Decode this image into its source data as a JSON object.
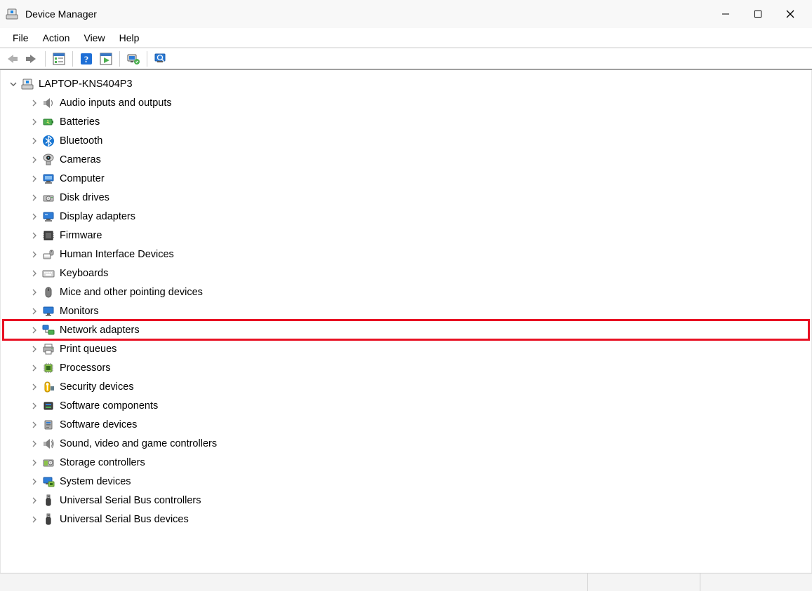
{
  "window": {
    "title": "Device Manager"
  },
  "menu": {
    "file": "File",
    "action": "Action",
    "view": "View",
    "help": "Help"
  },
  "toolbar": {
    "back": "Back",
    "forward": "Forward",
    "properties": "Show/Hide Console Tree",
    "help": "Help",
    "action_panel": "Properties",
    "scan": "Scan for hardware changes",
    "monitor": "Devices and Printers"
  },
  "tree": {
    "root": "LAPTOP-KNS404P3",
    "items": [
      {
        "label": "Audio inputs and outputs",
        "icon": "speaker"
      },
      {
        "label": "Batteries",
        "icon": "battery"
      },
      {
        "label": "Bluetooth",
        "icon": "bluetooth"
      },
      {
        "label": "Cameras",
        "icon": "camera"
      },
      {
        "label": "Computer",
        "icon": "computer"
      },
      {
        "label": "Disk drives",
        "icon": "disk"
      },
      {
        "label": "Display adapters",
        "icon": "display"
      },
      {
        "label": "Firmware",
        "icon": "firmware"
      },
      {
        "label": "Human Interface Devices",
        "icon": "hid"
      },
      {
        "label": "Keyboards",
        "icon": "keyboard"
      },
      {
        "label": "Mice and other pointing devices",
        "icon": "mouse"
      },
      {
        "label": "Monitors",
        "icon": "monitor"
      },
      {
        "label": "Network adapters",
        "icon": "network",
        "highlighted": true
      },
      {
        "label": "Print queues",
        "icon": "printer"
      },
      {
        "label": "Processors",
        "icon": "cpu"
      },
      {
        "label": "Security devices",
        "icon": "security"
      },
      {
        "label": "Software components",
        "icon": "swcomp"
      },
      {
        "label": "Software devices",
        "icon": "swdev"
      },
      {
        "label": "Sound, video and game controllers",
        "icon": "sound"
      },
      {
        "label": "Storage controllers",
        "icon": "storage"
      },
      {
        "label": "System devices",
        "icon": "system"
      },
      {
        "label": "Universal Serial Bus controllers",
        "icon": "usb"
      },
      {
        "label": "Universal Serial Bus devices",
        "icon": "usb"
      }
    ]
  }
}
